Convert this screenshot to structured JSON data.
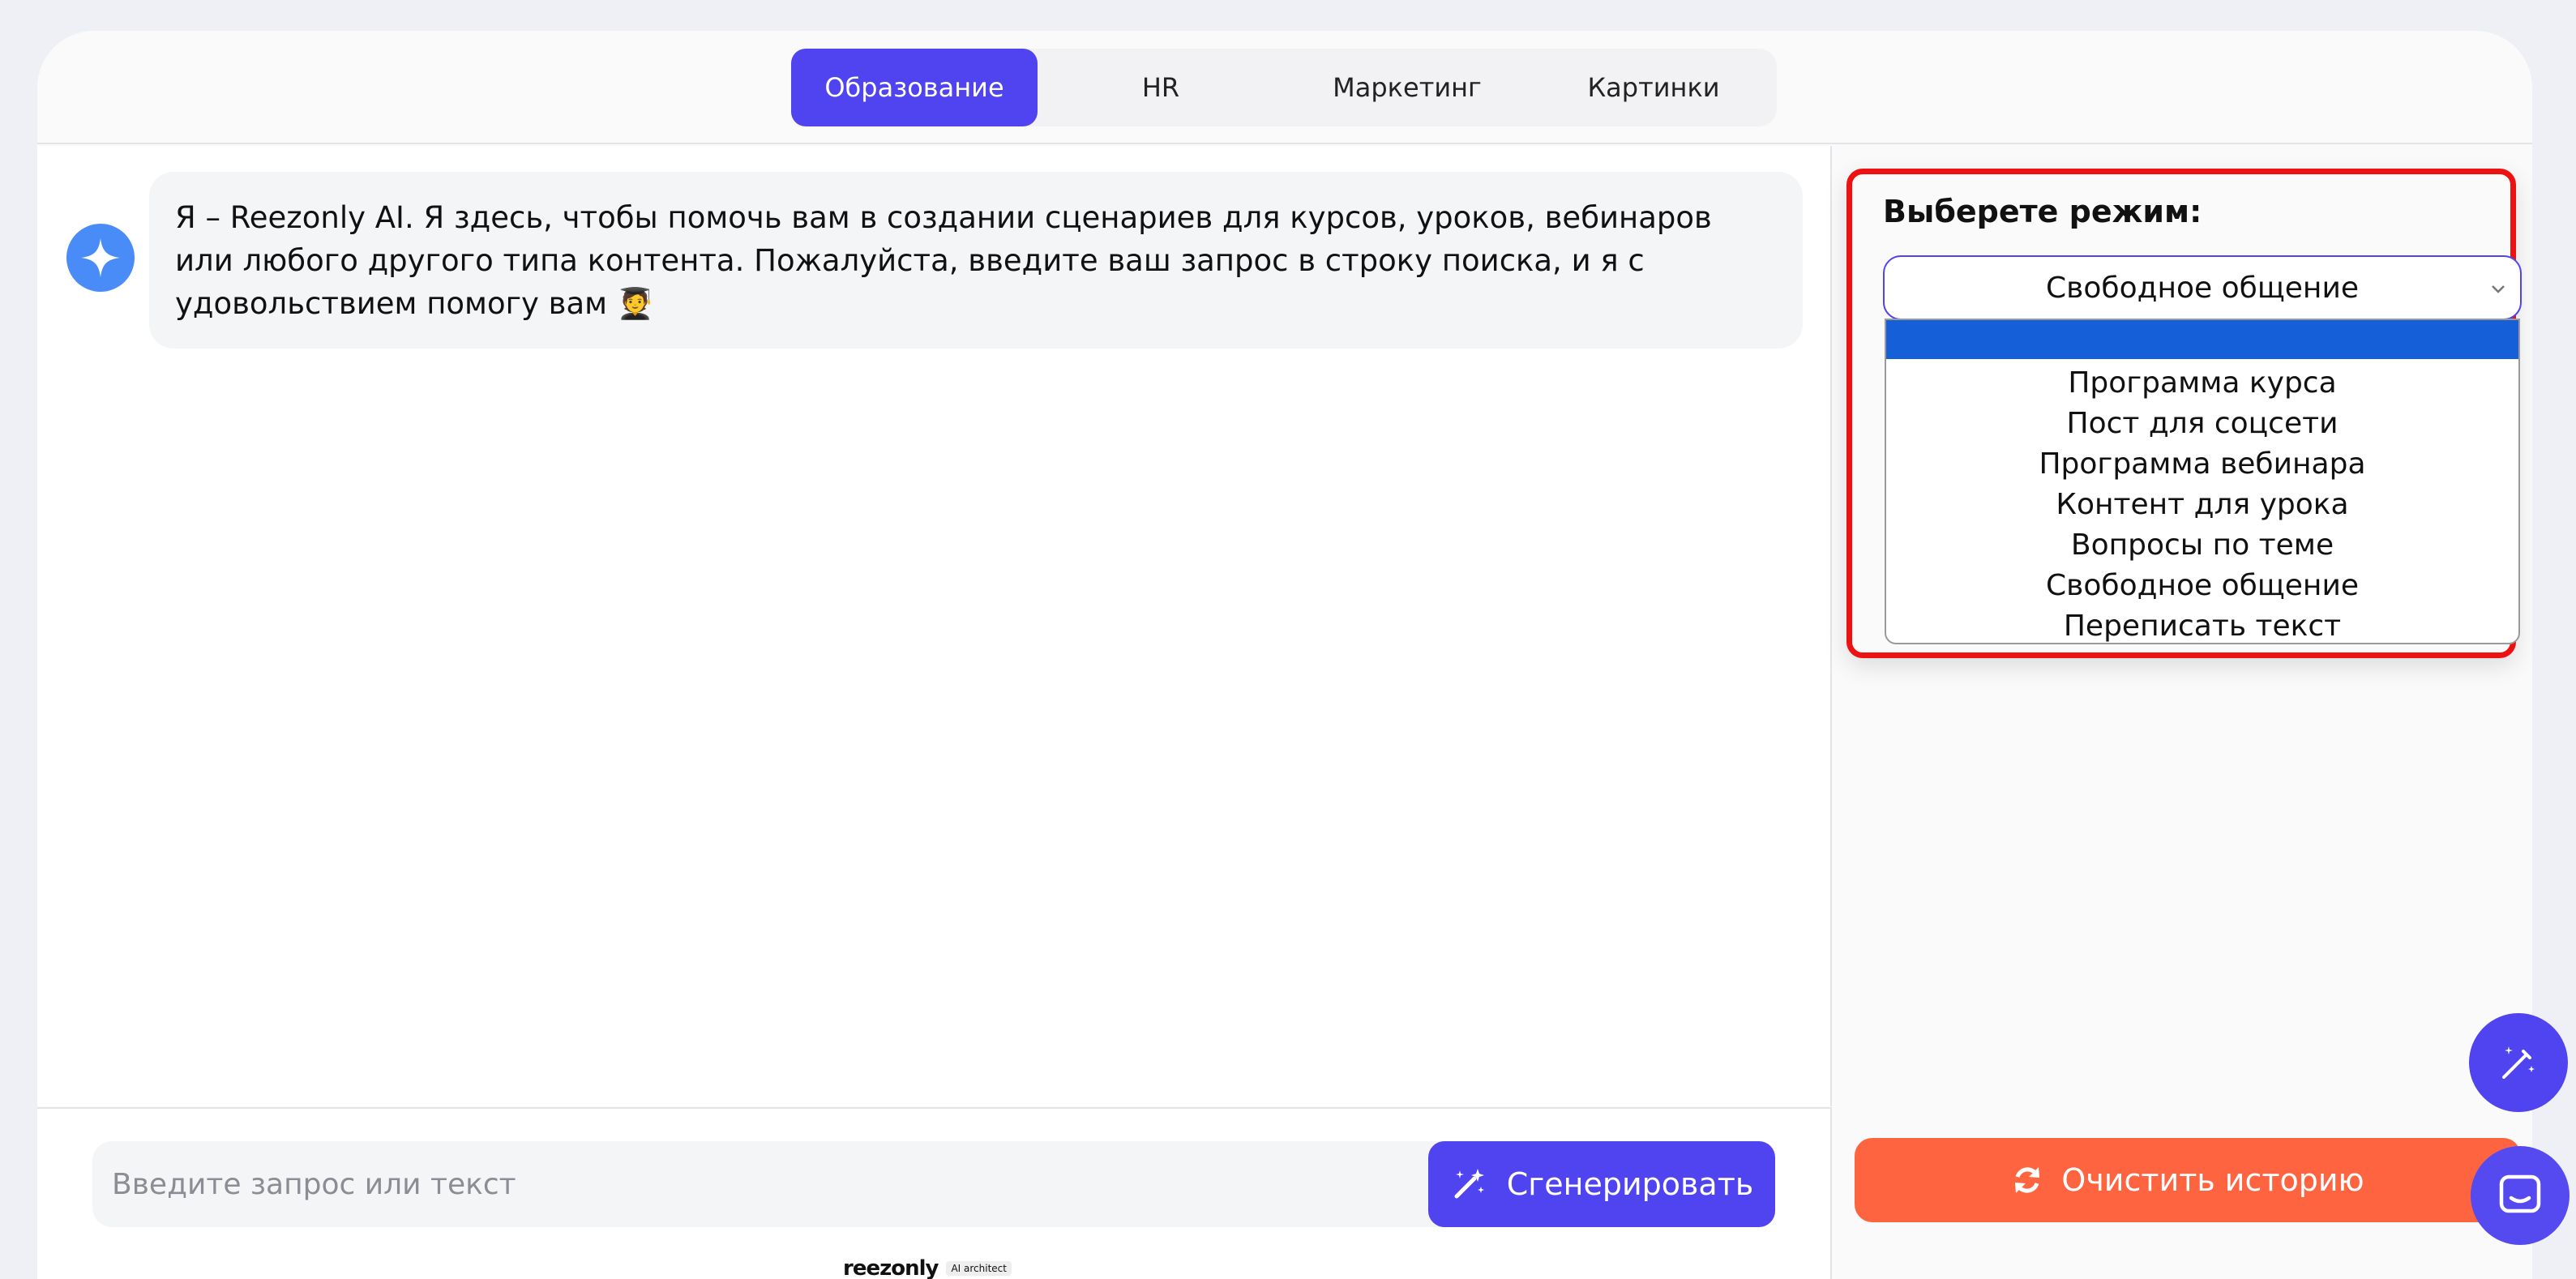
{
  "tabs": [
    {
      "label": "Образование",
      "active": true
    },
    {
      "label": "HR",
      "active": false
    },
    {
      "label": "Маркетинг",
      "active": false
    },
    {
      "label": "Картинки",
      "active": false
    }
  ],
  "chat": {
    "avatar_icon": "sparkle-icon",
    "message_line1": "Я – Reezonly AI.  Я здесь, чтобы помочь вам в создании сценариев для курсов, уроков, вебинаров",
    "message_line2": "или любого другого типа контента. Пожалуйста, введите ваш запрос в строку поиска, и я с",
    "message_line3": "удовольствием помогу вам 🧑‍🎓"
  },
  "input": {
    "placeholder": "Введите запрос или текст",
    "generate_label": "Сгенерировать",
    "generate_icon": "magic-wand-icon"
  },
  "footer_logo": {
    "word": "reezonly",
    "tag": "AI architect"
  },
  "mode": {
    "label": "Выберете режим:",
    "selected": "Свободное общение",
    "options": [
      "",
      "Программа курса",
      "Пост для соцсети",
      "Программа вебинара",
      "Контент для урока",
      "Вопросы по теме",
      "Свободное общение",
      "Переписать текст"
    ]
  },
  "clear_history": {
    "label": "Очистить историю",
    "icon": "refresh-icon"
  },
  "colors": {
    "accent": "#4f44ef",
    "clear": "#ff6440",
    "highlight": "#ee1111",
    "option_selected": "#1560d8"
  }
}
